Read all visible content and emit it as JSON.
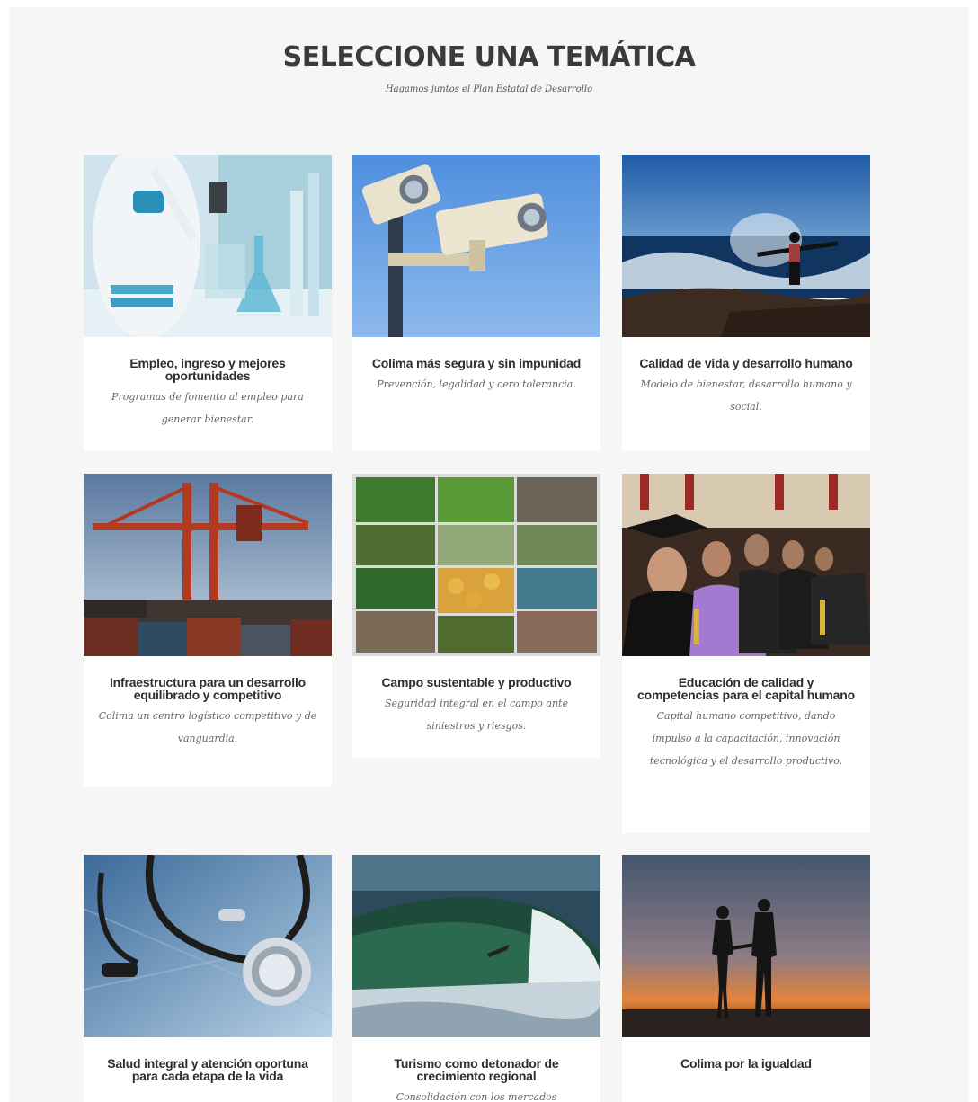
{
  "header": {
    "title": "SELECCIONE UNA TEMÁTICA",
    "subtitle": "Hagamos juntos el Plan Estatal de Desarrollo"
  },
  "cards": [
    {
      "title": "Empleo, ingreso y mejores oportunidades",
      "description": "Programas de fomento al empleo para generar bienestar.",
      "image": "laboratory-photo"
    },
    {
      "title": "Colima más segura y sin impunidad",
      "description": "Prevención, legalidad y cero tolerancia.",
      "image": "security-camera-photo"
    },
    {
      "title": "Calidad de vida y desarrollo humano",
      "description": "Modelo de bienestar, desarrollo humano y social.",
      "image": "ocean-person-photo"
    },
    {
      "title": "Infraestructura para un desarrollo equilibrado y competitivo",
      "description": "Colima un centro logístico competitivo y de vanguardia.",
      "image": "port-crane-photo"
    },
    {
      "title": "Campo sustentable y productivo",
      "description": "Seguridad integral en el campo ante siniestros y riesgos.",
      "image": "agriculture-collage-photo"
    },
    {
      "title": "Educación de calidad y competencias para el capital humano",
      "description": "Capital humano competitivo, dando impulso a la capacitación, innovación tecnológica y el desarrollo productivo.",
      "image": "graduates-photo"
    },
    {
      "title": "Salud integral y atención oportuna para cada etapa de la vida",
      "description": "",
      "image": "stethoscope-photo"
    },
    {
      "title": "Turismo como detonador de crecimiento regional",
      "description": "Consolidación con los mercados",
      "image": "surf-wave-photo"
    },
    {
      "title": "Colima por la igualdad",
      "description": "",
      "image": "sunset-couple-photo"
    }
  ]
}
